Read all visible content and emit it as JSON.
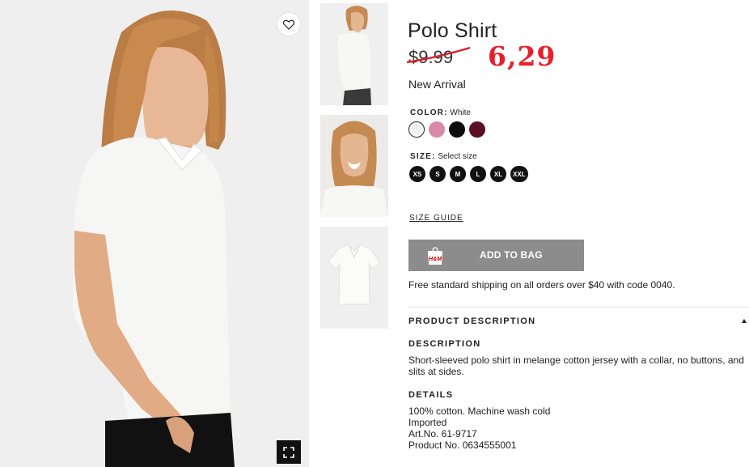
{
  "product": {
    "title": "Polo Shirt",
    "old_price": "$9.99",
    "new_price": "6,29",
    "badge": "New Arrival"
  },
  "color": {
    "label": "COLOR:",
    "selected": "White",
    "swatches": [
      {
        "name": "White",
        "hex": "#f2f2f2"
      },
      {
        "name": "Pink",
        "hex": "#d88aa8"
      },
      {
        "name": "Black",
        "hex": "#0d0d0d"
      },
      {
        "name": "Burgundy",
        "hex": "#5a0f24"
      }
    ]
  },
  "size": {
    "label": "SIZE:",
    "placeholder": "Select size",
    "options": [
      "XS",
      "S",
      "M",
      "L",
      "XL",
      "XXL"
    ]
  },
  "size_guide_label": "SIZE GUIDE",
  "add_to_bag": {
    "label": "ADD TO BAG",
    "bag_logo": "H&M",
    "button_color": "#8c8c8c"
  },
  "shipping_note": "Free standard shipping on all orders over $40 with code 0040.",
  "product_description": {
    "header": "PRODUCT DESCRIPTION",
    "description_title": "DESCRIPTION",
    "description_text": "Short-sleeved polo shirt in melange cotton jersey with a collar, no buttons, and slits at sides.",
    "details_title": "DETAILS",
    "details": [
      "100% cotton. Machine wash cold",
      "Imported",
      "Art.No. 61-9717",
      "Product No. 0634555001"
    ]
  },
  "icons": {
    "wishlist": "heart-icon",
    "fullscreen": "fullscreen-icon",
    "bag": "shopping-bag-icon",
    "collapse": "caret-up-icon"
  },
  "colors": {
    "price_markdown": "#e8202a",
    "strike_line": "#d8202a"
  }
}
